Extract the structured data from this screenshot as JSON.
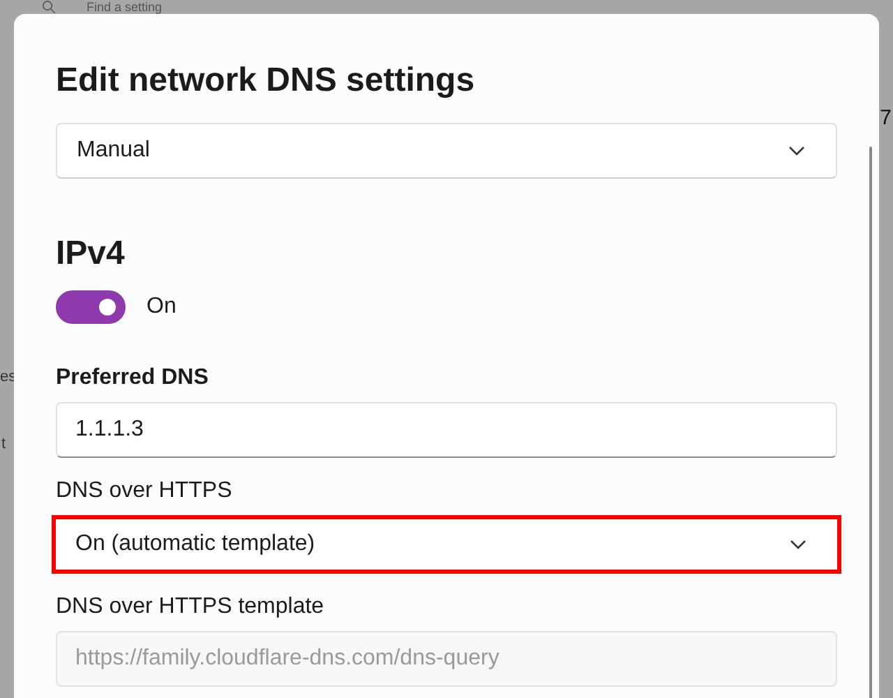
{
  "background": {
    "search": {
      "placeholder": "Find a setting"
    },
    "fragments": [
      "7",
      "es",
      "t"
    ]
  },
  "dialog": {
    "title": "Edit network DNS settings",
    "mode_dropdown": {
      "value": "Manual"
    },
    "section": {
      "title": "IPv4",
      "toggle": {
        "on": true,
        "label": "On"
      }
    },
    "fields": [
      {
        "kind": "input",
        "label": "Preferred DNS",
        "bold": true,
        "value": "1.1.1.3",
        "disabled": false,
        "highlighted": false
      },
      {
        "kind": "dropdown",
        "label": "DNS over HTTPS",
        "bold": false,
        "value": "On (automatic template)",
        "disabled": false,
        "highlighted": true
      },
      {
        "kind": "input",
        "label": "DNS over HTTPS template",
        "bold": false,
        "placeholder": "https://family.cloudflare-dns.com/dns-query",
        "disabled": true,
        "highlighted": false
      }
    ]
  }
}
